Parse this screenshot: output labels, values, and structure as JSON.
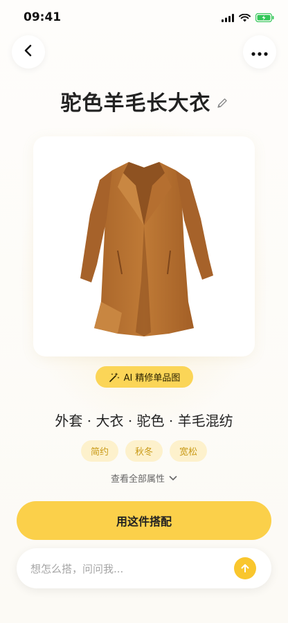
{
  "status_bar": {
    "time": "09:41",
    "icons": [
      "signal-icon",
      "wifi-icon",
      "battery-charging-icon"
    ],
    "battery_color": "#34c759"
  },
  "header": {
    "back_icon": "chevron-left-icon",
    "more_icon": "more-dots-icon"
  },
  "item": {
    "title": "驼色羊毛长大衣",
    "edit_icon": "pencil-icon",
    "image_alt": "camel wool long coat",
    "coat_color": "#b8722e",
    "ai_badge": {
      "label": "AI 精修单品图",
      "icon": "magic-wand-icon"
    },
    "attributes_line": "外套 · 大衣 · 驼色 · 羊毛混纺",
    "tags": [
      "简约",
      "秋冬",
      "宽松"
    ],
    "view_all_label": "查看全部属性"
  },
  "actions": {
    "primary_label": "用这件搭配"
  },
  "chat": {
    "placeholder": "想怎么搭，问问我...",
    "send_icon": "arrow-up-icon"
  },
  "colors": {
    "accent": "#fbd04a",
    "tag_bg": "#fdf1cc",
    "tag_text": "#c99a17"
  }
}
